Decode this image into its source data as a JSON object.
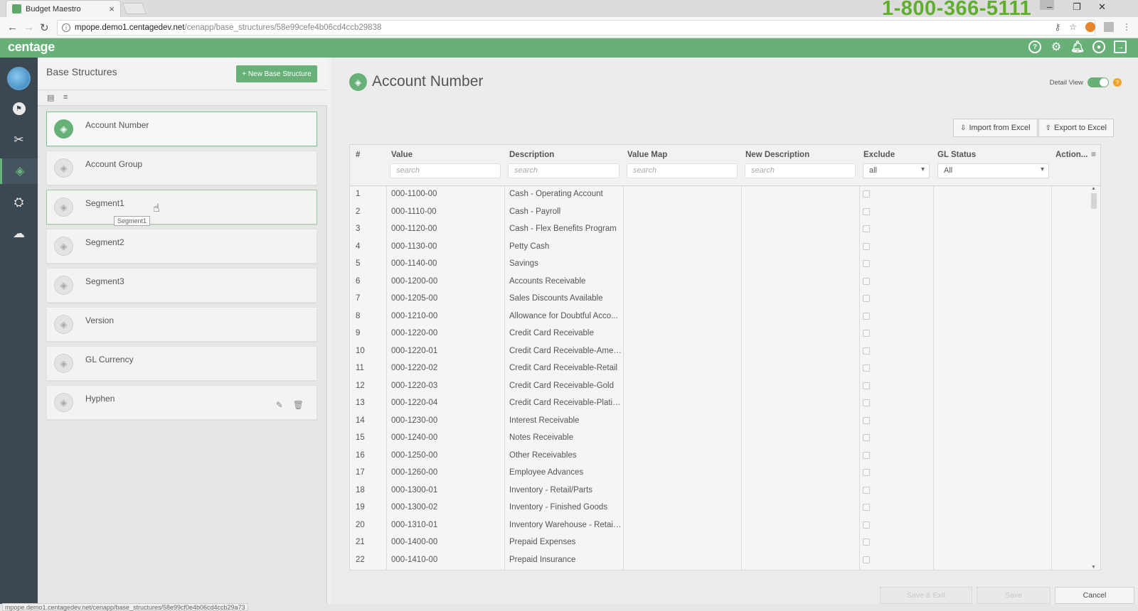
{
  "browser": {
    "tab_title": "Budget Maestro",
    "tab_close": "×",
    "phone": "1-800-366-5111",
    "url_host": "mpope.demo1.centagedev.net",
    "url_path": "/cenapp/base_structures/58e99cefe4b06cd4ccb29838",
    "status_url": "mpope.demo1.centagedev.net/cenapp/base_structures/58e99cf0e4b06cd4ccb29a73",
    "minimize": "–",
    "restore": "❐",
    "close": "✕"
  },
  "app": {
    "logo": "centage",
    "accent": "#67b178"
  },
  "left_panel": {
    "title": "Base Structures",
    "new_button": "+ New Base Structure",
    "items": [
      {
        "label": "Account Number"
      },
      {
        "label": "Account Group"
      },
      {
        "label": "Segment1"
      },
      {
        "label": "Segment2"
      },
      {
        "label": "Segment3"
      },
      {
        "label": "Version"
      },
      {
        "label": "GL Currency"
      },
      {
        "label": "Hyphen"
      }
    ],
    "tooltip": "Segment1"
  },
  "main": {
    "title": "Account Number",
    "detail_view_label": "Detail View",
    "import_button": "Import from Excel",
    "export_button": "Export to Excel",
    "columns": {
      "num": "#",
      "value": "Value",
      "description": "Description",
      "value_map": "Value Map",
      "new_description": "New Description",
      "exclude": "Exclude",
      "gl_status": "GL Status",
      "actions": "Action..."
    },
    "filters": {
      "value_placeholder": "search",
      "description_placeholder": "search",
      "value_map_placeholder": "search",
      "new_description_placeholder": "search",
      "exclude_selected": "all",
      "gl_status_selected": "All"
    },
    "rows": [
      {
        "num": "1",
        "value": "000-1100-00",
        "description": "Cash - Operating Account"
      },
      {
        "num": "2",
        "value": "000-1110-00",
        "description": "Cash - Payroll"
      },
      {
        "num": "3",
        "value": "000-1120-00",
        "description": "Cash - Flex Benefits Program"
      },
      {
        "num": "4",
        "value": "000-1130-00",
        "description": "Petty Cash"
      },
      {
        "num": "5",
        "value": "000-1140-00",
        "description": "Savings"
      },
      {
        "num": "6",
        "value": "000-1200-00",
        "description": "Accounts Receivable"
      },
      {
        "num": "7",
        "value": "000-1205-00",
        "description": "Sales Discounts Available"
      },
      {
        "num": "8",
        "value": "000-1210-00",
        "description": "Allowance for Doubtful Acco..."
      },
      {
        "num": "9",
        "value": "000-1220-00",
        "description": "Credit Card Receivable"
      },
      {
        "num": "10",
        "value": "000-1220-01",
        "description": "Credit Card Receivable-Ameri..."
      },
      {
        "num": "11",
        "value": "000-1220-02",
        "description": "Credit Card Receivable-Retail"
      },
      {
        "num": "12",
        "value": "000-1220-03",
        "description": "Credit Card Receivable-Gold"
      },
      {
        "num": "13",
        "value": "000-1220-04",
        "description": "Credit Card Receivable-Platin..."
      },
      {
        "num": "14",
        "value": "000-1230-00",
        "description": "Interest Receivable"
      },
      {
        "num": "15",
        "value": "000-1240-00",
        "description": "Notes Receivable"
      },
      {
        "num": "16",
        "value": "000-1250-00",
        "description": "Other Receivables"
      },
      {
        "num": "17",
        "value": "000-1260-00",
        "description": "Employee Advances"
      },
      {
        "num": "18",
        "value": "000-1300-01",
        "description": "Inventory - Retail/Parts"
      },
      {
        "num": "19",
        "value": "000-1300-02",
        "description": "Inventory - Finished Goods"
      },
      {
        "num": "20",
        "value": "000-1310-01",
        "description": "Inventory Warehouse - Retail/..."
      },
      {
        "num": "21",
        "value": "000-1400-00",
        "description": "Prepaid Expenses"
      },
      {
        "num": "22",
        "value": "000-1410-00",
        "description": "Prepaid Insurance"
      }
    ],
    "footer": {
      "save_exit": "Save & Exit",
      "save": "Save",
      "cancel": "Cancel"
    }
  }
}
